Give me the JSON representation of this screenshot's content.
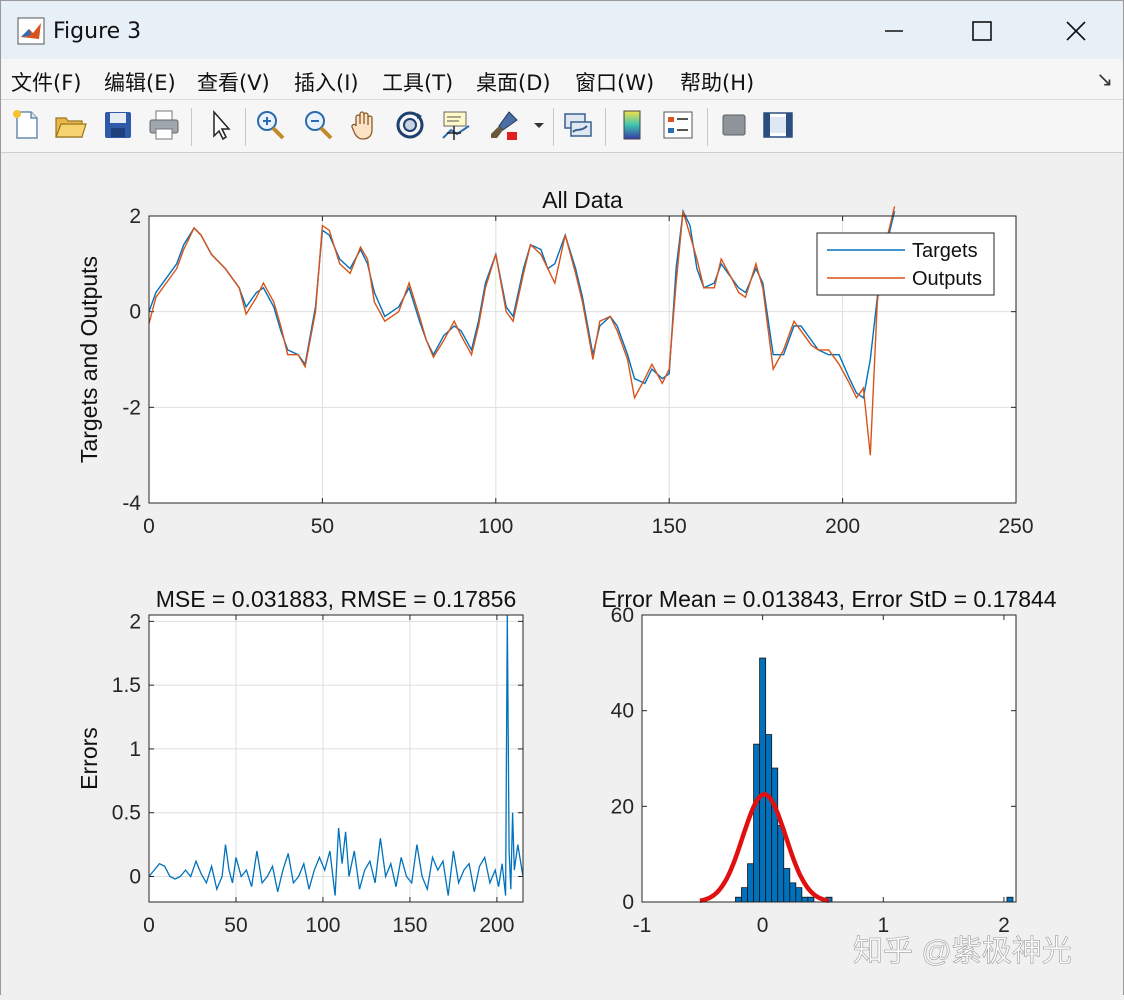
{
  "window": {
    "title": "Figure 3",
    "minimize_label": "minimize",
    "maximize_label": "maximize",
    "close_label": "close"
  },
  "menu": {
    "items": [
      "文件(F)",
      "编辑(E)",
      "查看(V)",
      "插入(I)",
      "工具(T)",
      "桌面(D)",
      "窗口(W)",
      "帮助(H)"
    ]
  },
  "toolbar": {
    "icons": [
      "new-figure-icon",
      "open-file-icon",
      "save-icon",
      "print-icon",
      "edit-plot-arrow-icon",
      "zoom-in-icon",
      "zoom-out-icon",
      "pan-hand-icon",
      "rotate-3d-icon",
      "data-cursor-icon",
      "brush-icon",
      "link-plot-icon",
      "insert-colorbar-icon",
      "insert-legend-icon",
      "hide-plot-tools-icon",
      "show-plot-tools-icon"
    ]
  },
  "watermark": "知乎 @紫极神光",
  "chart_data": [
    {
      "type": "line",
      "title": "All Data",
      "xlabel": "",
      "ylabel": "Targets and Outputs",
      "xlim": [
        0,
        250
      ],
      "ylim": [
        -4,
        2
      ],
      "xticks": [
        "0",
        "50",
        "100",
        "150",
        "200",
        "250"
      ],
      "yticks": [
        "-4",
        "-2",
        "0",
        "2"
      ],
      "grid": true,
      "legend": "top-right",
      "colors": {
        "Targets": "#0072BD",
        "Outputs": "#D95319"
      },
      "x": [
        0,
        2,
        5,
        8,
        10,
        13,
        15,
        18,
        22,
        26,
        28,
        31,
        33,
        36,
        38,
        40,
        43,
        45,
        48,
        50,
        52,
        55,
        58,
        61,
        63,
        65,
        68,
        72,
        75,
        78,
        80,
        82,
        85,
        88,
        90,
        93,
        95,
        97,
        100,
        103,
        105,
        108,
        110,
        113,
        115,
        117,
        120,
        123,
        125,
        128,
        130,
        133,
        135,
        138,
        140,
        143,
        145,
        148,
        150,
        152,
        154,
        156,
        158,
        160,
        163,
        165,
        168,
        170,
        172,
        175,
        177,
        180,
        183,
        186,
        188,
        191,
        193,
        196,
        199,
        202,
        204,
        206,
        208,
        210,
        212,
        215
      ],
      "series": [
        {
          "name": "Targets",
          "values": [
            0.0,
            0.4,
            0.7,
            1.0,
            1.4,
            1.75,
            1.6,
            1.2,
            0.9,
            0.5,
            0.1,
            0.4,
            0.5,
            0.1,
            -0.4,
            -0.8,
            -0.9,
            -1.1,
            0.1,
            1.7,
            1.6,
            1.1,
            0.9,
            1.3,
            1.0,
            0.4,
            -0.1,
            0.1,
            0.5,
            -0.2,
            -0.6,
            -0.9,
            -0.5,
            -0.3,
            -0.4,
            -0.8,
            -0.2,
            0.6,
            1.2,
            0.1,
            -0.1,
            0.9,
            1.4,
            1.3,
            0.9,
            1.0,
            1.6,
            0.9,
            0.3,
            -0.9,
            -0.3,
            -0.1,
            -0.3,
            -0.9,
            -1.4,
            -1.5,
            -1.2,
            -1.4,
            -1.3,
            0.9,
            2.1,
            1.8,
            0.9,
            0.5,
            0.6,
            1.0,
            0.7,
            0.5,
            0.4,
            0.9,
            0.6,
            -0.9,
            -0.9,
            -0.3,
            -0.3,
            -0.6,
            -0.8,
            -0.9,
            -0.9,
            -1.4,
            -1.7,
            -1.8,
            -1.0,
            0.3,
            1.2,
            2.1
          ]
        },
        {
          "name": "Outputs",
          "values": [
            -0.25,
            0.3,
            0.6,
            0.9,
            1.3,
            1.75,
            1.6,
            1.2,
            0.9,
            0.5,
            -0.05,
            0.3,
            0.6,
            0.2,
            -0.3,
            -0.9,
            -0.9,
            -1.15,
            0.0,
            1.8,
            1.7,
            1.0,
            0.8,
            1.35,
            1.1,
            0.2,
            -0.2,
            0.0,
            0.6,
            -0.1,
            -0.6,
            -0.95,
            -0.6,
            -0.2,
            -0.5,
            -0.9,
            -0.3,
            0.5,
            1.2,
            0.0,
            -0.2,
            0.8,
            1.4,
            1.2,
            0.9,
            0.6,
            1.6,
            0.8,
            0.2,
            -1.0,
            -0.2,
            -0.1,
            -0.4,
            -1.0,
            -1.8,
            -1.4,
            -1.1,
            -1.5,
            -1.2,
            0.6,
            2.1,
            1.6,
            1.1,
            0.5,
            0.5,
            1.1,
            0.7,
            0.4,
            0.3,
            1.0,
            0.5,
            -1.2,
            -0.8,
            -0.2,
            -0.4,
            -0.7,
            -0.8,
            -0.8,
            -1.1,
            -1.5,
            -1.8,
            -1.6,
            -3.0,
            0.2,
            1.3,
            2.2
          ]
        }
      ]
    },
    {
      "type": "line",
      "title": "MSE = 0.031883, RMSE = 0.17856",
      "xlabel": "",
      "ylabel": "Errors",
      "xlim": [
        0,
        215
      ],
      "ylim": [
        -0.2,
        2.05
      ],
      "xticks": [
        "0",
        "50",
        "100",
        "150",
        "200"
      ],
      "yticks": [
        "0",
        "0.5",
        "1",
        "1.5",
        "2"
      ],
      "grid": true,
      "colors": {
        "line": "#0072BD"
      },
      "x": [
        0,
        3,
        6,
        9,
        12,
        15,
        18,
        21,
        24,
        27,
        30,
        33,
        36,
        39,
        42,
        44,
        46,
        48,
        50,
        53,
        56,
        59,
        62,
        65,
        68,
        71,
        74,
        77,
        80,
        83,
        86,
        89,
        92,
        95,
        98,
        101,
        104,
        107,
        109,
        111,
        113,
        115,
        118,
        121,
        124,
        127,
        130,
        133,
        136,
        139,
        142,
        145,
        148,
        151,
        154,
        157,
        160,
        163,
        166,
        169,
        172,
        175,
        178,
        181,
        184,
        187,
        190,
        193,
        196,
        199,
        201,
        203,
        205,
        206,
        207,
        208,
        209,
        210,
        212,
        215
      ],
      "values": [
        0.0,
        0.05,
        0.1,
        0.08,
        0.0,
        -0.02,
        0.0,
        0.05,
        0.0,
        0.12,
        0.02,
        -0.05,
        0.08,
        -0.1,
        0.0,
        0.25,
        0.05,
        -0.05,
        0.15,
        0.0,
        0.05,
        -0.08,
        0.2,
        -0.05,
        0.0,
        0.08,
        -0.12,
        0.05,
        0.18,
        -0.05,
        0.0,
        0.1,
        -0.1,
        0.05,
        0.15,
        0.05,
        0.2,
        -0.15,
        0.38,
        0.1,
        0.35,
        0.0,
        0.2,
        -0.1,
        0.05,
        0.12,
        -0.05,
        0.3,
        0.0,
        0.1,
        -0.08,
        0.15,
        0.0,
        -0.05,
        0.25,
        0.0,
        -0.1,
        0.15,
        0.05,
        0.12,
        -0.15,
        0.2,
        -0.05,
        0.05,
        0.1,
        -0.12,
        0.08,
        0.15,
        -0.05,
        0.05,
        -0.08,
        0.1,
        -0.15,
        2.05,
        0.2,
        -0.1,
        0.5,
        0.05,
        0.25,
        0.0
      ]
    },
    {
      "type": "bar",
      "title": "Error Mean = 0.013843, Error StD = 0.17844",
      "xlabel": "",
      "ylabel": "",
      "xlim": [
        -1,
        2.1
      ],
      "ylim": [
        0,
        60
      ],
      "xticks": [
        "-1",
        "0",
        "1",
        "2"
      ],
      "yticks": [
        "0",
        "20",
        "40",
        "60"
      ],
      "grid": false,
      "colors": {
        "bars": "#0072BD",
        "fit": "#E01010"
      },
      "bin_centers": [
        -0.2,
        -0.15,
        -0.1,
        -0.05,
        0.0,
        0.05,
        0.1,
        0.15,
        0.2,
        0.25,
        0.3,
        0.35,
        0.4,
        0.45,
        0.5,
        0.55,
        2.05
      ],
      "values": [
        1,
        3,
        8,
        33,
        51,
        35,
        28,
        16,
        7,
        4,
        3,
        1,
        1,
        0,
        0,
        1,
        1
      ],
      "bin_width": 0.05,
      "fit": {
        "name": "normal fit",
        "mean": 0.013843,
        "std": 0.17844,
        "peak": 22.5
      }
    }
  ]
}
